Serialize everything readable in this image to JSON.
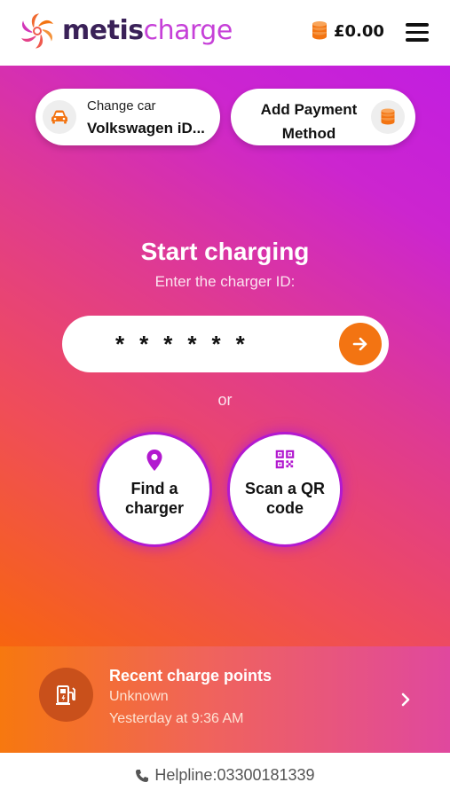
{
  "brand": {
    "name_part1": "metis",
    "name_part2": "charge",
    "colors": {
      "orange": "#f37412",
      "purple": "#c21ee0",
      "dark_purple": "#3a2158",
      "pink": "#c640d8"
    }
  },
  "header": {
    "balance": "£0.00",
    "balance_icon": "coins-icon",
    "menu_icon": "hamburger-menu-icon"
  },
  "quick_actions": {
    "change_car": {
      "label": "Change car",
      "value": "Volkswagen iD...",
      "icon": "car-icon"
    },
    "add_payment": {
      "label": "Add Payment Method",
      "icon": "coins-icon"
    }
  },
  "start": {
    "title": "Start charging",
    "subtitle": "Enter the charger ID:",
    "input_value": "******",
    "submit_icon": "arrow-right-icon"
  },
  "or_text": "or",
  "options": {
    "find": {
      "label": "Find a charger",
      "icon": "location-pin-icon"
    },
    "scan": {
      "label": "Scan a QR code",
      "icon": "qr-code-icon"
    }
  },
  "recent": {
    "title": "Recent charge points",
    "location": "Unknown",
    "time": "Yesterday at 9:36 AM",
    "icon": "charge-station-icon",
    "chevron": "chevron-right-icon"
  },
  "footer": {
    "helpline": "Helpline:03300181339",
    "icon": "phone-icon"
  }
}
